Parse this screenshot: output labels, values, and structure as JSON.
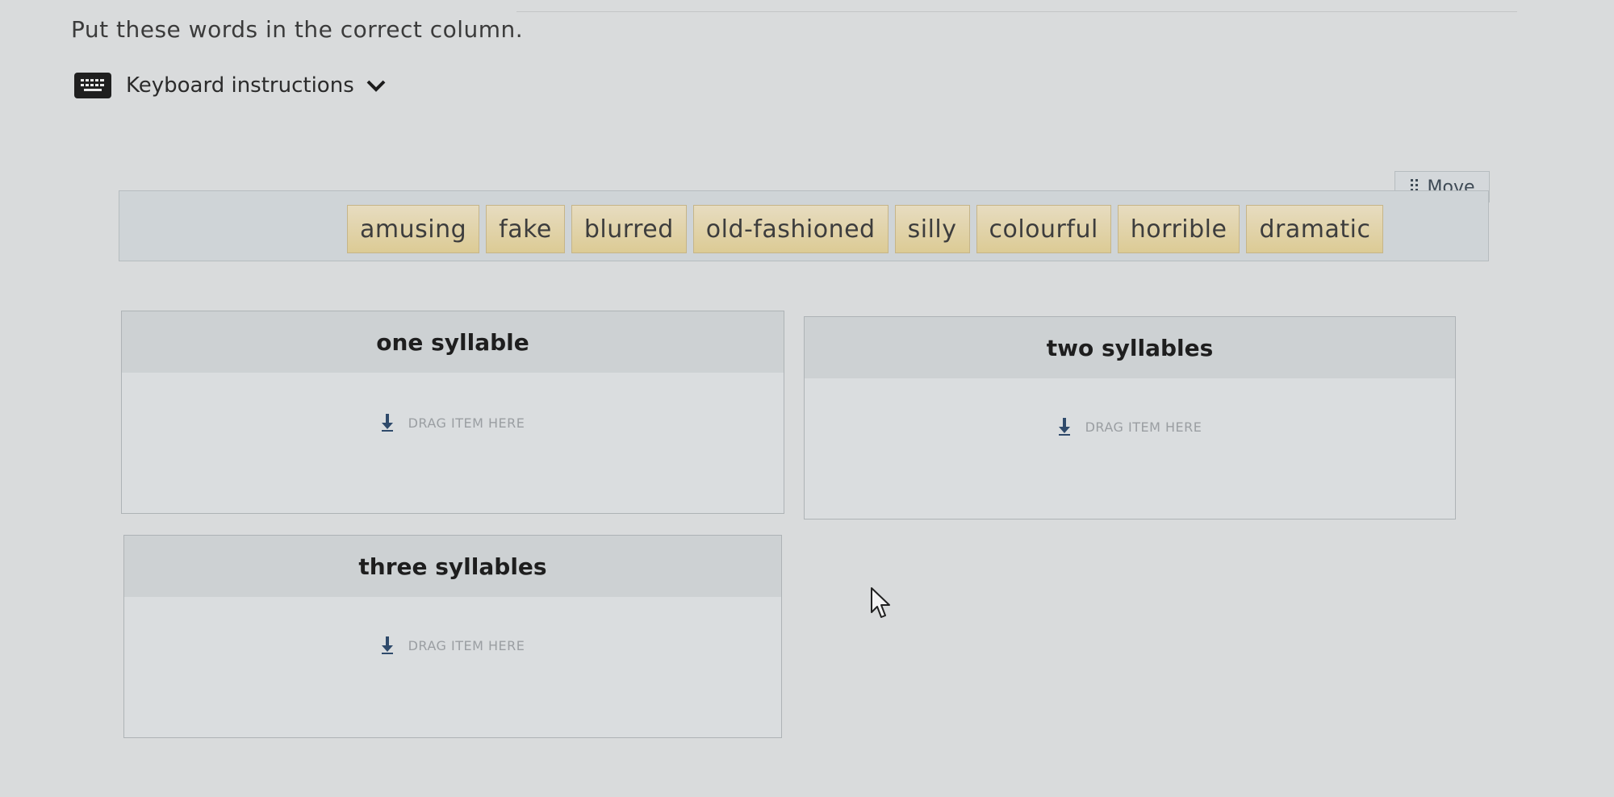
{
  "instruction": "Put these words in the correct column.",
  "keyboard": {
    "label": "Keyboard instructions",
    "icon": "keyboard-icon",
    "toggle_icon": "chevron-down-icon"
  },
  "word_bank": {
    "move_label": "Move",
    "move_icon": "grip-icon",
    "words": [
      "amusing",
      "fake",
      "blurred",
      "old-fashioned",
      "silly",
      "colourful",
      "horrible",
      "dramatic"
    ]
  },
  "columns": [
    {
      "title": "one syllable",
      "placeholder": "DRAG ITEM HERE"
    },
    {
      "title": "two syllables",
      "placeholder": "DRAG ITEM HERE"
    },
    {
      "title": "three syllables",
      "placeholder": "DRAG ITEM HERE"
    }
  ],
  "colors": {
    "token_fill": "#dccb95",
    "token_border": "#c6b588",
    "drop_arrow": "#2f4a6b"
  }
}
